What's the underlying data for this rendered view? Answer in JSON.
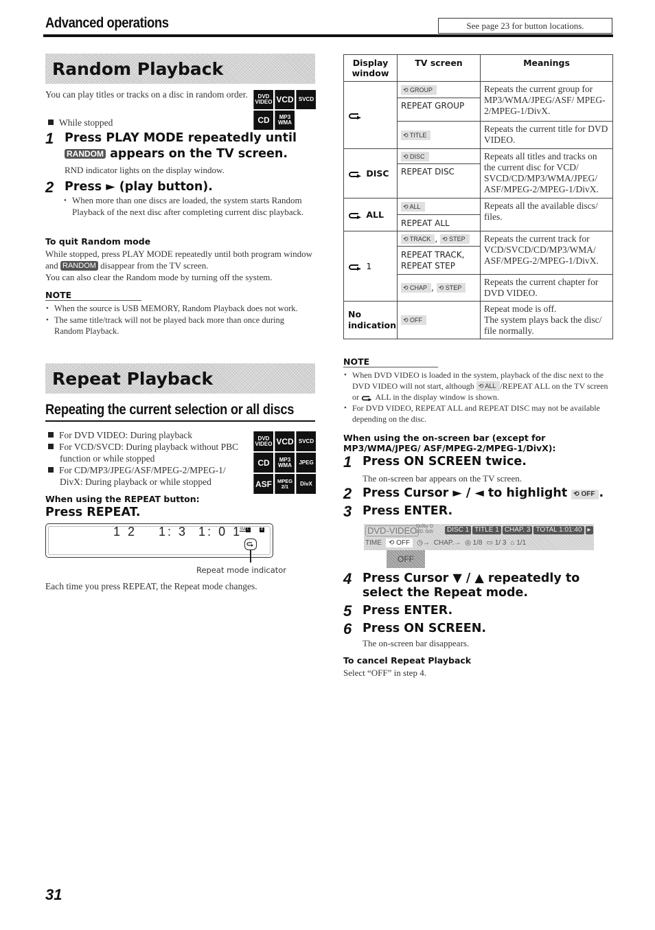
{
  "header": {
    "section_title": "Advanced operations",
    "page_reference": "See page 23 for button locations."
  },
  "random": {
    "banner": "Random Playback",
    "intro": "You can play titles or tracks on a disc in random order.",
    "condition": "While stopped",
    "discs": [
      "DVD VIDEO",
      "VCD",
      "SVCD",
      "CD",
      "MP3 WMA"
    ],
    "step1_num": "1",
    "step1_line1": "Press PLAY MODE repeatedly until",
    "step1_chip": "RANDOM",
    "step1_line2": "appears on the TV screen.",
    "step1_detail": "RND indicator lights on the display window.",
    "step2_num": "2",
    "step2_title": "Press ► (play button).",
    "step2_detail": "When more than one discs are loaded, the system starts Random Playback of the next disc after completing current disc playback.",
    "quit_heading": "To quit Random mode",
    "quit_text_a": "While stopped, press PLAY MODE repeatedly until both program window and",
    "quit_chip": "RANDOM",
    "quit_text_b": "disappear from the TV screen.",
    "quit_text_c": "You can also clear the Random mode by turning off the system.",
    "note_heading": "NOTE",
    "notes": [
      "When the source is USB MEMORY, Random Playback does not work.",
      "The same title/track will not be played back more than once during Random Playback."
    ]
  },
  "repeat": {
    "banner": "Repeat Playback",
    "subheading": "Repeating the current selection or all discs",
    "conditions": [
      "For DVD VIDEO: During playback",
      "For VCD/SVCD: During playback without PBC function or while stopped",
      "For CD/MP3/JPEG/ASF/MPEG-2/MPEG-1/ DivX: During playback or while stopped"
    ],
    "discs": [
      "DVD VIDEO",
      "VCD",
      "SVCD",
      "CD",
      "MP3 WMA",
      "JPEG",
      "ASF",
      "MPEG 2/1",
      "DivX"
    ],
    "button_heading": "When using the REPEAT button:",
    "press_repeat": "Press REPEAT.",
    "display_readout": "1 2    1: 3  1: 0 1",
    "display_sw": "SW",
    "display_l": "L",
    "display_r": "R",
    "indicator_label": "Repeat mode indicator",
    "each_time": "Each time you press REPEAT, the Repeat mode changes."
  },
  "table": {
    "headers": [
      "Display window",
      "TV screen",
      "Meanings"
    ],
    "rows": [
      {
        "display": "",
        "tv_icon": "GROUP",
        "tv_text": "REPEAT GROUP",
        "meaning": "Repeats the current group for MP3/WMA/JPEG/ASF/ MPEG-2/MPEG-1/DivX."
      },
      {
        "tv_icon": "TITLE",
        "meaning": "Repeats the current title for DVD VIDEO."
      },
      {
        "display": "DISC",
        "tv_icon": "DISC",
        "tv_text": "REPEAT DISC",
        "meaning": "Repeats all titles and tracks on the current disc for VCD/ SVCD/CD/MP3/WMA/JPEG/ ASF/MPEG-2/MPEG-1/DivX."
      },
      {
        "display": "ALL",
        "tv_icon": "ALL",
        "tv_text": "REPEAT ALL",
        "meaning": "Repeats all the available discs/ files."
      },
      {
        "display": "1",
        "tv_icon": "TRACK",
        "tv_icon2": "STEP",
        "tv_text": "REPEAT TRACK, REPEAT STEP",
        "meaning": "Repeats the current track for VCD/SVCD/CD/MP3/WMA/ ASF/MPEG-2/MPEG-1/DivX."
      },
      {
        "tv_icon": "CHAP",
        "tv_icon2": "STEP",
        "meaning": "Repeats the current chapter for DVD VIDEO."
      },
      {
        "display": "No indication",
        "tv_icon": "OFF",
        "meaning_a": "Repeat mode is off.",
        "meaning_b": "The system plays back the disc/ file normally."
      }
    ]
  },
  "right_note": {
    "heading": "NOTE",
    "note1_a": "When DVD VIDEO is loaded in the system, playback of the disc next to the DVD VIDEO will not start, although",
    "note1_chip": "ALL",
    "note1_b": "/REPEAT ALL on the TV screen or",
    "note1_c": "ALL in the display window is shown.",
    "note2": "For DVD VIDEO, REPEAT ALL and REPEAT DISC may not be available depending on the disc."
  },
  "onscreen": {
    "heading": "When using the on-screen bar (except for MP3/WMA/JPEG/ ASF/MPEG-2/MPEG-1/DivX):",
    "steps": [
      {
        "num": "1",
        "title": "Press ON SCREEN twice.",
        "detail": "The on-screen bar appears on the TV screen."
      },
      {
        "num": "2",
        "title": "Press Cursor ► / ◄ to highlight",
        "chip": "OFF"
      },
      {
        "num": "3",
        "title": "Press ENTER."
      },
      {
        "num": "4",
        "title": "Press Cursor ▼ / ▲ repeatedly to select the Repeat mode."
      },
      {
        "num": "5",
        "title": "Press ENTER."
      },
      {
        "num": "6",
        "title": "Press ON SCREEN.",
        "detail": "The on-screen bar disappears."
      }
    ],
    "bar": {
      "source": "DVD-VIDEO",
      "audio_a": "Dolby D",
      "audio_b": "2/0. 0ch",
      "disc": "DISC 1",
      "title": "TITLE 1",
      "chap": "CHAP. 3",
      "total": "TOTAL 1:01:40",
      "time": "TIME",
      "repeat": "OFF",
      "chap_arrow": "CHAP.→",
      "audio_track": "1/8",
      "subtitle": "1/ 3",
      "angle": "1/1",
      "dropdown": "OFF"
    },
    "cancel_heading": "To cancel Repeat Playback",
    "cancel_text": "Select “OFF” in step 4."
  },
  "page_number": "31"
}
